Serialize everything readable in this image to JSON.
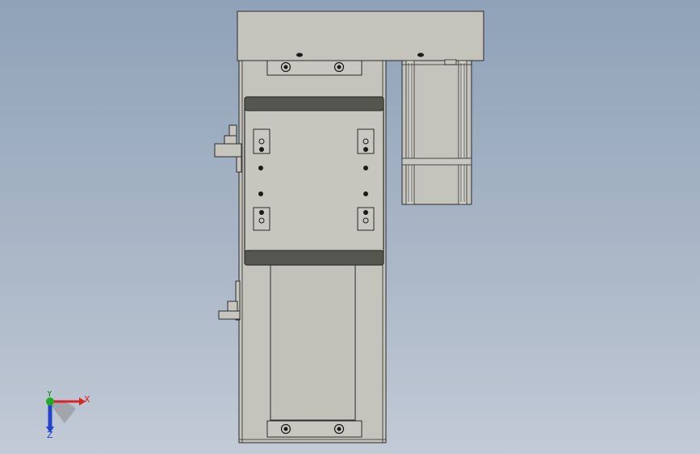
{
  "viewport": {
    "background_top": "#8fa2b8",
    "background_bottom": "#c2cad6"
  },
  "model": {
    "body_color": "#c4c4bc",
    "edge_color": "#2a2a2a",
    "carriage_band_color": "#55574f",
    "hole_color": "#1a1a1a"
  },
  "triad": {
    "x_label": "X",
    "y_label": "Y",
    "z_label": "Z",
    "x_color": "#dd2222",
    "y_color": "#22aa22",
    "z_color": "#2244cc"
  }
}
